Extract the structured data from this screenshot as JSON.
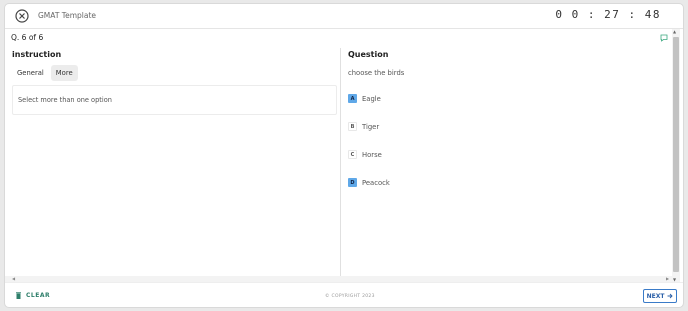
{
  "header": {
    "title": "GMAT Template",
    "timer": "0 0 : 27 : 48",
    "close_icon": "close-circle-icon"
  },
  "question_counter": "Q. 6 of 6",
  "instruction": {
    "title": "instruction",
    "tabs": [
      {
        "label": "General",
        "active": true
      },
      {
        "label": "More",
        "active": false
      }
    ],
    "text": "Select more than one option"
  },
  "question": {
    "title": "Question",
    "text": "choose the birds",
    "options": [
      {
        "letter": "A",
        "label": "Eagle",
        "selected": true
      },
      {
        "letter": "B",
        "label": "Tiger",
        "selected": false
      },
      {
        "letter": "C",
        "label": "Horse",
        "selected": false
      },
      {
        "letter": "D",
        "label": "Peacock",
        "selected": true
      }
    ]
  },
  "footer": {
    "clear_label": "CLEAR",
    "copyright": "© COPYRIGHT 2023",
    "next_label": "NEXT"
  },
  "colors": {
    "selected_option": "#5fa8e8",
    "clear_green": "#2f7f6b",
    "next_blue": "#2a5fa8"
  }
}
